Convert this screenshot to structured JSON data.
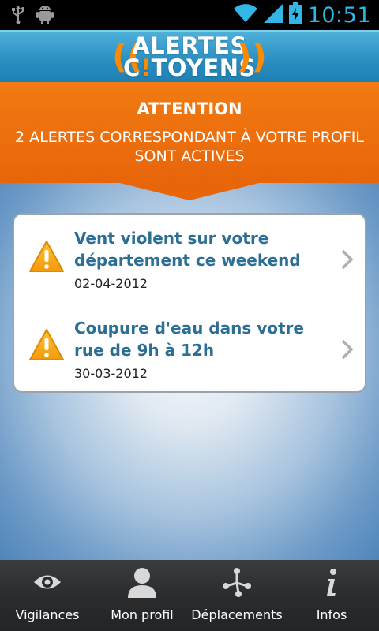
{
  "status_bar": {
    "time": "10:51",
    "icons": [
      "usb-icon",
      "android-debug-icon",
      "wifi-icon",
      "signal-icon",
      "battery-charging-icon"
    ],
    "accent_color": "#33b5e5"
  },
  "app_header": {
    "logo_line1": "ALERTES",
    "logo_line2_prefix": "C",
    "logo_line2_excl": "!",
    "logo_line2_suffix": "TOYENS"
  },
  "banner": {
    "title": "ATTENTION",
    "message": "2 ALERTES CORRESPONDANT À VOTRE PROFIL SONT ACTIVES",
    "color": "#e8650a"
  },
  "alerts": [
    {
      "title": "Vent violent sur votre département ce weekend",
      "date": "02-04-2012",
      "icon": "warning-icon"
    },
    {
      "title": "Coupure d'eau dans votre rue de 9h à 12h",
      "date": "30-03-2012",
      "icon": "warning-icon"
    }
  ],
  "bottom_nav": {
    "items": [
      {
        "label": "Vigilances",
        "icon": "eye-icon"
      },
      {
        "label": "Mon profil",
        "icon": "person-icon"
      },
      {
        "label": "Déplacements",
        "icon": "route-icon"
      },
      {
        "label": "Infos",
        "icon": "info-icon"
      }
    ]
  }
}
